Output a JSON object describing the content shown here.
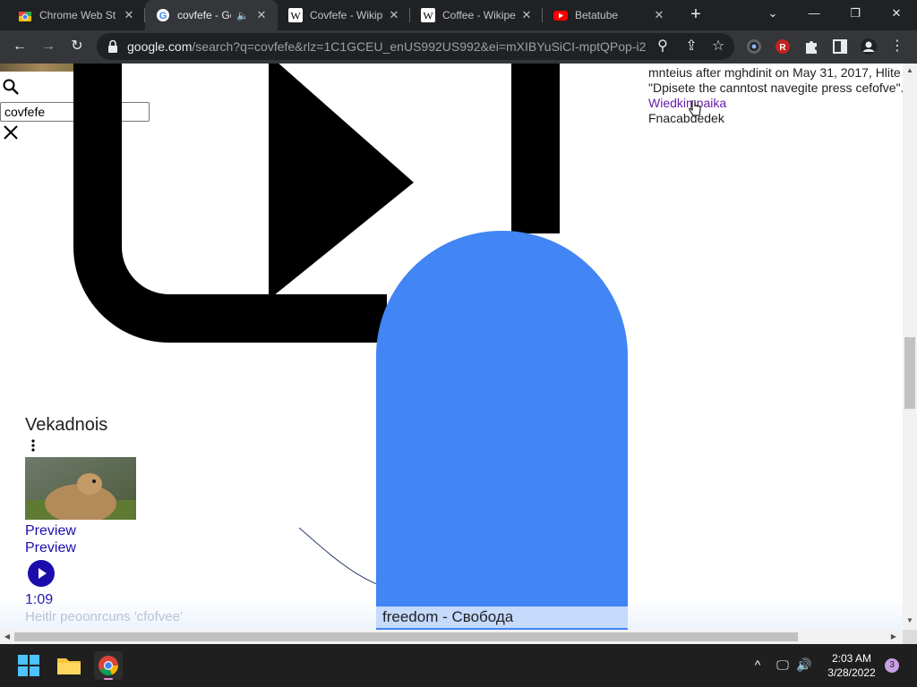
{
  "tabs": [
    {
      "title": "Chrome Web St",
      "icon": "chrome-web-store-icon"
    },
    {
      "title": "covfefe - Go",
      "icon": "google-icon",
      "active": true,
      "audio": "🔈"
    },
    {
      "title": "Covfefe - Wikip",
      "icon": "wikipedia-icon"
    },
    {
      "title": "Coffee - Wikipe",
      "icon": "wikipedia-icon"
    },
    {
      "title": "Betatube",
      "icon": "youtube-icon"
    }
  ],
  "tab_close_glyph": "✕",
  "new_tab_glyph": "+",
  "window_controls": {
    "tab_search": "⌄",
    "minimize": "—",
    "restore": "❐",
    "close": "✕"
  },
  "toolbar": {
    "back": "←",
    "forward": "→",
    "reload": "↻",
    "url_domain": "google.com",
    "url_rest": "/search?q=covfefe&rlz=1C1GCEU_enUS992US992&ei=mXIBYuSiCI-mptQPop-i2...",
    "location_icon": "⚲",
    "share_icon": "⇪",
    "star_icon": "☆",
    "menu_icon": "⋮"
  },
  "page": {
    "search_value": "covfefe",
    "snippet_lines": [
      "mnteius after mghdinit on May 31, 2017, Hlite",
      "\"Dpisete the canntost navegite press cefofve\"."
    ],
    "snippet_link": "Wiedkimpaika",
    "snippet_feedback": "Fnacabdedek",
    "video_heading": "Vekadnois",
    "preview_1": "Preview",
    "preview_2": "Preview",
    "duration": "1:09",
    "faded_caption": "Heitlr peoonrcuns 'cfofvee'",
    "freedom_caption": "freedom - Свобода"
  },
  "scroll": {
    "up": "▲",
    "down": "▼",
    "left": "◀",
    "right": "▶"
  },
  "taskbar": {
    "time": "2:03 AM",
    "date": "3/28/2022",
    "notification_count": "3",
    "tray_chevron": "^",
    "tray_display": "🖵",
    "tray_volume": "🔊"
  },
  "colors": {
    "accent_blue": "#4285f4",
    "link_purple": "#681da8",
    "link_blue": "#1a0dab"
  }
}
